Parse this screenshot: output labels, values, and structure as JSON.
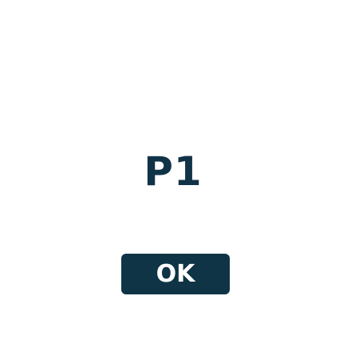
{
  "screen": {
    "title": "P1",
    "ok_label": "OK"
  },
  "colors": {
    "title_text": "#113348",
    "button_background": "#0e3446",
    "button_text": "#ffffff",
    "background": "#ffffff"
  }
}
